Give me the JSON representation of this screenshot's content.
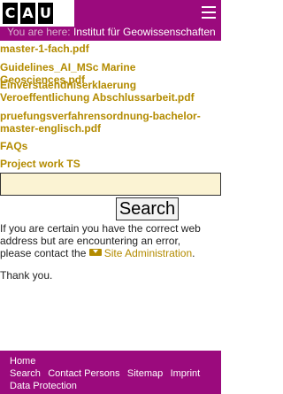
{
  "header": {
    "logo_letters": [
      "C",
      "A",
      "U"
    ],
    "menu_icon": "hamburger-menu-icon"
  },
  "breadcrumb": {
    "prefix": "You are here:",
    "current": "Institut für Geowissenschaften"
  },
  "links": [
    "master-1-fach.pdf",
    "Guidelines_AI_MSc Marine Geosciences.pdf",
    "Einverstaendniserklaerung Veroeffentlichung Abschlussarbeit.pdf",
    "pruefungsverfahrensordnung-bachelor-master-englisch.pdf",
    "FAQs",
    "Project work TS"
  ],
  "search": {
    "input_value": "",
    "button_label": "Search"
  },
  "message": {
    "text_before": "If you are certain you have the correct web address but are encountering an error, please contact the",
    "admin_icon": "mail-icon",
    "admin_link": "Site Administration",
    "text_after": ".",
    "thanks": "Thank you."
  },
  "footer": {
    "home": "Home",
    "search": "Search",
    "contact": "Contact Persons",
    "sitemap": "Sitemap",
    "imprint": "Imprint",
    "data_protection": "Data Protection"
  },
  "colors": {
    "brand": "#9b0a7d",
    "link": "#b38b00",
    "input_bg": "#fbf3d3"
  }
}
